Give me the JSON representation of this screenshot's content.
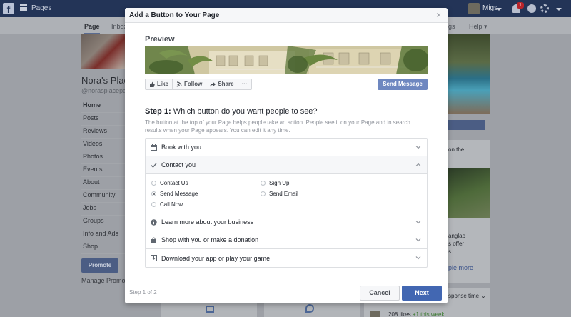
{
  "topbar": {
    "logo": "f",
    "pages_label": "Pages",
    "user_name": "Migs",
    "notification_count": "1"
  },
  "subnav": {
    "page_tab": "Page",
    "inbox_tab": "Inbox",
    "settings_tab_partial": "gs",
    "help_tab": "Help ▾"
  },
  "page": {
    "name": "Nora's Place",
    "handle": "@norasplacepa",
    "nav_items": [
      "Home",
      "Posts",
      "Reviews",
      "Videos",
      "Photos",
      "Events",
      "About",
      "Community",
      "Jobs",
      "Groups",
      "Info and Ads",
      "Shop"
    ],
    "promote_label": "Promote",
    "manage_label": "Manage Promotio"
  },
  "right_column": {
    "text1": "on the",
    "text2_lines": [
      "anglao",
      "s offer",
      "s"
    ],
    "link": "ple more",
    "response_text": "sponse time",
    "likes_count": "208 likes",
    "likes_delta": "+1 this week"
  },
  "modal": {
    "title": "Add a Button to Your Page",
    "close_glyph": "×",
    "preview_label": "Preview",
    "actions": [
      {
        "label": "Like",
        "icon": "thumbs-up-icon"
      },
      {
        "label": "Follow",
        "icon": "rss-icon"
      },
      {
        "label": "Share",
        "icon": "share-arrow-icon"
      },
      {
        "label": "···",
        "icon": "more-icon"
      }
    ],
    "send_message_label": "Send Message",
    "step_prefix": "Step 1:",
    "step_question": " Which button do you want people to see?",
    "step_description": "The button at the top of your Page helps people take an action. People see it on your Page and in search results when your Page appears. You can edit it any time.",
    "options": [
      {
        "label": "Book with you",
        "icon": "calendar-icon",
        "expanded": false
      },
      {
        "label": "Contact you",
        "icon": "checkmark-icon",
        "expanded": true
      },
      {
        "label": "Learn more about your business",
        "icon": "info-icon",
        "expanded": false
      },
      {
        "label": "Shop with you or make a donation",
        "icon": "shopping-bag-icon",
        "expanded": false
      },
      {
        "label": "Download your app or play your game",
        "icon": "download-icon",
        "expanded": false
      }
    ],
    "contact_choices": {
      "contact_us": "Contact Us",
      "sign_up": "Sign Up",
      "send_message": "Send Message",
      "send_email": "Send Email",
      "call_now": "Call Now",
      "selected": "Send Message"
    },
    "step_count": "Step 1 of 2",
    "cancel_label": "Cancel",
    "next_label": "Next"
  },
  "colors": {
    "topbar": "#233457",
    "primary_button": "#4267b2",
    "send_message_button": "#6e87c0",
    "header_bg": "#f6f7f9"
  }
}
